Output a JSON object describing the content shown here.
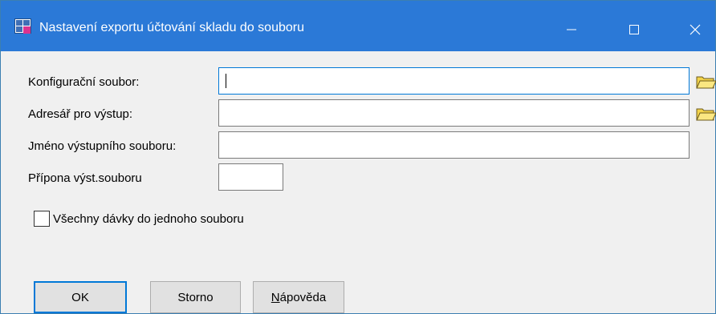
{
  "window": {
    "title": "Nastavení exportu účtování skladu do souboru",
    "accent_color": "#2b79d7",
    "controls": [
      "minimize-icon",
      "maximize-icon",
      "close-icon"
    ]
  },
  "form": {
    "config_label": "Konfigurační soubor:",
    "config_value": "",
    "dir_label": "Adresář pro výstup:",
    "dir_value": "",
    "name_label": "Jméno výstupního souboru:",
    "name_value": "",
    "ext_label": "Přípona výst.souboru",
    "ext_value": "",
    "browse_icon": "folder-open-icon"
  },
  "checkbox": {
    "label": "Všechny dávky do jednoho souboru",
    "checked": false
  },
  "buttons": {
    "ok": "OK",
    "storno": "Storno",
    "help_underlined": "N",
    "help_rest": "ápověda"
  }
}
